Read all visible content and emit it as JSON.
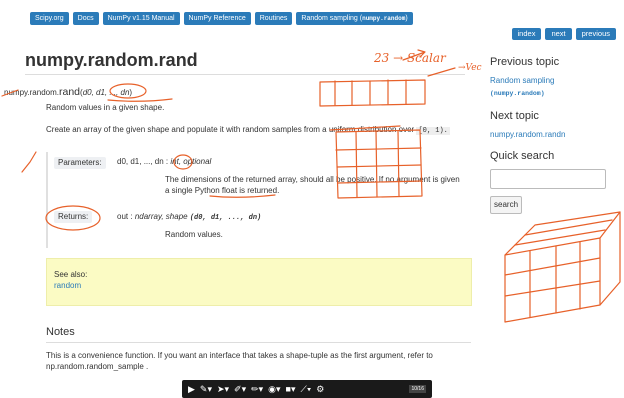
{
  "topnav": {
    "crumbs": [
      "Scipy.org",
      "Docs",
      "NumPy v1.15 Manual",
      "NumPy Reference",
      "Routines"
    ],
    "last_crumb_text": "Random sampling (",
    "last_crumb_code": "numpy.random",
    "last_crumb_close": ")"
  },
  "relnav": {
    "index": "index",
    "next": "next",
    "previous": "previous"
  },
  "page": {
    "title": "numpy.random.rand",
    "sig_module": "numpy.random.",
    "sig_func": "rand",
    "sig_open": "(",
    "sig_args": "d0, d1, ..., dn",
    "sig_close": ")",
    "desc": "Random values in a given shape.",
    "create_text": "Create an array of the given shape and populate it with random samples from a uniform distribution over",
    "create_code": "[0, 1).",
    "params_label": "Parameters:",
    "param_names": "d0, d1, ..., dn :",
    "param_type": "int, optional",
    "param_desc": "The dimensions of the returned array, should all be positive. If no argument is given a single Python float is returned.",
    "returns_label": "Returns:",
    "returns_name": "out :",
    "returns_type": "ndarray, shape",
    "returns_code": "(d0, d1, ..., dn)",
    "returns_desc": "Random values.",
    "seealso_title": "See also:",
    "seealso_link": "random",
    "notes_title": "Notes",
    "notes_body": "This is a convenience function. If you want an interface that takes a shape-tuple as the first argument, refer to np.random.random_sample ."
  },
  "sidebar": {
    "prev_title": "Previous topic",
    "prev_link": "Random sampling",
    "prev_link_code": "(numpy.random)",
    "next_title": "Next topic",
    "next_link": "numpy.random.randn",
    "qs_title": "Quick search",
    "qs_placeholder": "",
    "qs_button": "search"
  },
  "annotations": {
    "scalar_note": "23 → Scalar",
    "vec_note": "→Vec",
    "color": "#e7612a"
  },
  "toolbar": {
    "icons": [
      "play-icon",
      "pen-icon",
      "pointer-icon",
      "highlighter-icon",
      "marker-icon",
      "eraser-icon",
      "shape-icon",
      "line-icon",
      "settings-icon"
    ],
    "page_indicator": "10/16"
  }
}
